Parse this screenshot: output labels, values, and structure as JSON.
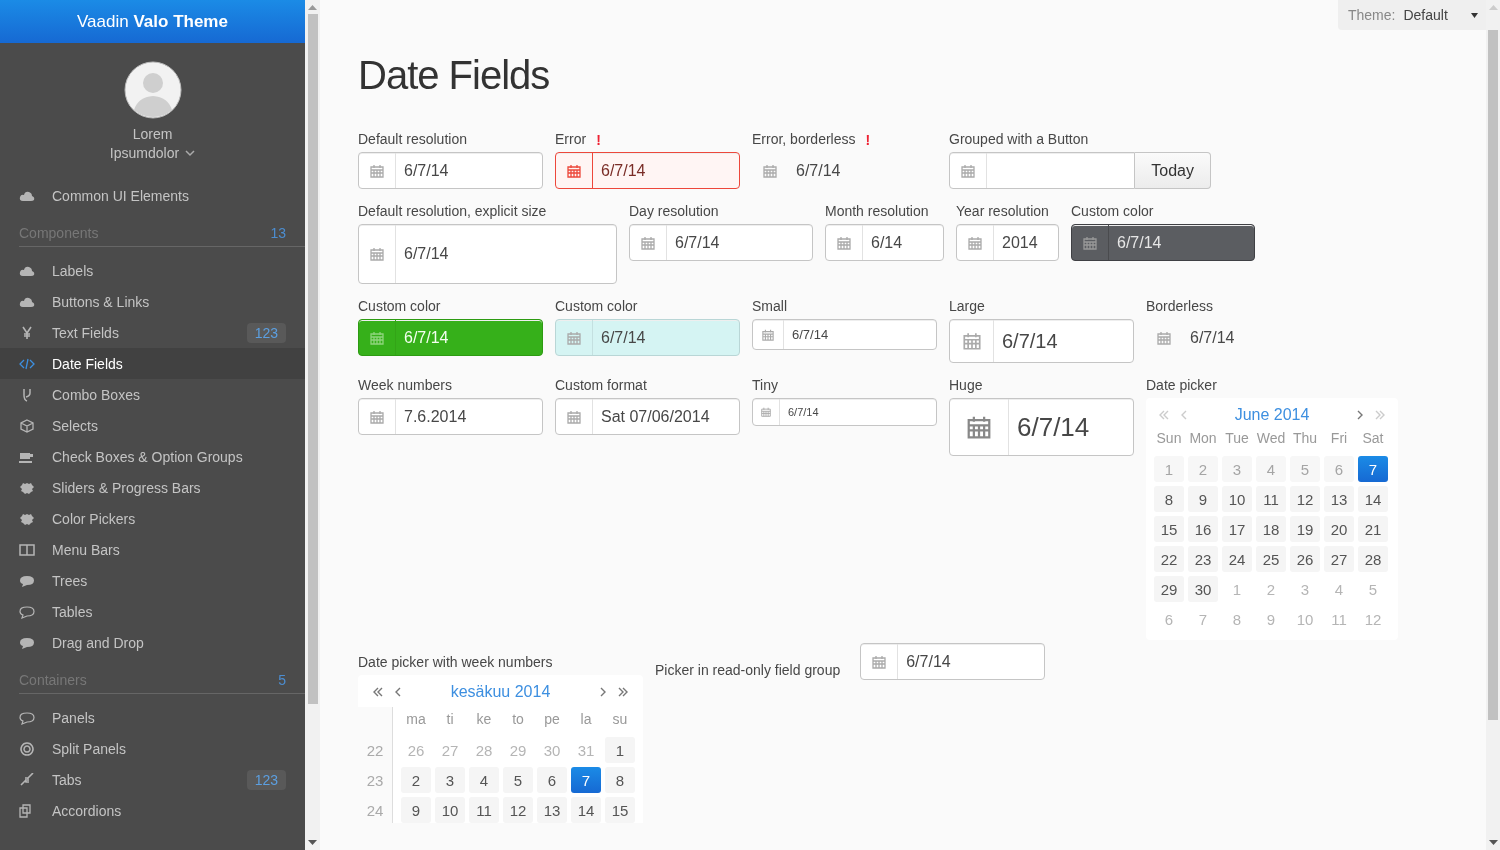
{
  "sidebar": {
    "title": "Vaadin **Valo Theme**",
    "user": {
      "first": "Lorem",
      "last": "Ipsumdolor"
    },
    "menu": [
      {
        "kind": "item",
        "label": "Common UI Elements",
        "selected": false
      },
      {
        "kind": "section",
        "label": "Components",
        "count": "13"
      },
      {
        "kind": "item",
        "label": "Labels",
        "selected": false
      },
      {
        "kind": "item",
        "label": "Buttons & Links",
        "selected": false
      },
      {
        "kind": "item",
        "label": "Text Fields",
        "badge": "123",
        "selected": false
      },
      {
        "kind": "item",
        "label": "Date Fields",
        "selected": true
      },
      {
        "kind": "item",
        "label": "Combo Boxes",
        "selected": false
      },
      {
        "kind": "item",
        "label": "Selects",
        "selected": false
      },
      {
        "kind": "item",
        "label": "Check Boxes & Option Groups",
        "selected": false
      },
      {
        "kind": "item",
        "label": "Sliders & Progress Bars",
        "selected": false
      },
      {
        "kind": "item",
        "label": "Color Pickers",
        "selected": false
      },
      {
        "kind": "item",
        "label": "Menu Bars",
        "selected": false
      },
      {
        "kind": "item",
        "label": "Trees",
        "selected": false
      },
      {
        "kind": "item",
        "label": "Tables",
        "selected": false
      },
      {
        "kind": "item",
        "label": "Drag and Drop",
        "selected": false
      },
      {
        "kind": "section",
        "label": "Containers",
        "count": "5"
      },
      {
        "kind": "item",
        "label": "Panels",
        "selected": false
      },
      {
        "kind": "item",
        "label": "Split Panels",
        "selected": false
      },
      {
        "kind": "item",
        "label": "Tabs",
        "badge": "123",
        "selected": false
      },
      {
        "kind": "item",
        "label": "Accordions",
        "selected": false
      }
    ]
  },
  "theme_select": {
    "label": "Theme:",
    "value": "Default"
  },
  "title": "Date Fields",
  "rows": [
    [
      {
        "label": "Default resolution",
        "value": "6/7/14",
        "kind": "default"
      },
      {
        "label": "Error",
        "error_mark": "!",
        "value": "6/7/14",
        "kind": "error"
      },
      {
        "label": "Error, borderless",
        "error_mark": "!",
        "value": "6/7/14",
        "kind": "borderless"
      },
      {
        "label": "Grouped with a Button",
        "button": "Today",
        "kind": "grouped"
      }
    ],
    [
      {
        "label": "Default resolution, explicit size",
        "value": "6/7/14",
        "kind": "explicit"
      },
      {
        "label": "Day resolution",
        "value": "6/7/14",
        "kind": "default"
      },
      {
        "label": "Month resolution",
        "value": "6/14",
        "kind": "default"
      },
      {
        "label": "Year resolution",
        "value": "2014",
        "kind": "default"
      },
      {
        "label": "Custom color",
        "value": "6/7/14",
        "kind": "dark"
      }
    ],
    [
      {
        "label": "Custom color",
        "value": "6/7/14",
        "kind": "green"
      },
      {
        "label": "Custom color",
        "value": "6/7/14",
        "kind": "cyan"
      },
      {
        "label": "Small",
        "value": "6/7/14",
        "kind": "small"
      },
      {
        "label": "Large",
        "value": "6/7/14",
        "kind": "large"
      },
      {
        "label": "Borderless",
        "value": "6/7/14",
        "kind": "borderless"
      }
    ],
    [
      {
        "label": "Week numbers",
        "value": "7.6.2014",
        "kind": "default"
      },
      {
        "label": "Custom format",
        "value": "Sat 07/06/2014",
        "kind": "default"
      },
      {
        "label": "Tiny",
        "value": "6/7/14",
        "kind": "tiny"
      },
      {
        "label": "Huge",
        "value": "6/7/14",
        "kind": "huge"
      }
    ]
  ],
  "date_picker": {
    "label": "Date picker",
    "month": "June 2014",
    "prev_disabled": true,
    "weekdays": [
      "Sun",
      "Mon",
      "Tue",
      "Wed",
      "Thu",
      "Fri",
      "Sat"
    ],
    "weeks": [
      [
        {
          "day": "1",
          "muted": false,
          "disabled": true,
          "selected": false
        },
        {
          "day": "2",
          "muted": false,
          "disabled": true,
          "selected": false
        },
        {
          "day": "3",
          "muted": false,
          "disabled": true,
          "selected": false
        },
        {
          "day": "4",
          "muted": false,
          "disabled": true,
          "selected": false
        },
        {
          "day": "5",
          "muted": false,
          "disabled": true,
          "selected": false
        },
        {
          "day": "6",
          "muted": false,
          "disabled": true,
          "selected": false
        },
        {
          "day": "7",
          "muted": false,
          "disabled": false,
          "selected": true
        }
      ],
      [
        {
          "day": "8",
          "muted": false,
          "selected": false
        },
        {
          "day": "9",
          "muted": false,
          "selected": false
        },
        {
          "day": "10",
          "muted": false,
          "selected": false
        },
        {
          "day": "11",
          "muted": false,
          "selected": false
        },
        {
          "day": "12",
          "muted": false,
          "selected": false
        },
        {
          "day": "13",
          "muted": false,
          "selected": false
        },
        {
          "day": "14",
          "muted": false,
          "selected": false
        }
      ],
      [
        {
          "day": "15",
          "muted": false,
          "selected": false
        },
        {
          "day": "16",
          "muted": false,
          "selected": false
        },
        {
          "day": "17",
          "muted": false,
          "selected": false
        },
        {
          "day": "18",
          "muted": false,
          "selected": false
        },
        {
          "day": "19",
          "muted": false,
          "selected": false
        },
        {
          "day": "20",
          "muted": false,
          "selected": false
        },
        {
          "day": "21",
          "muted": false,
          "selected": false
        }
      ],
      [
        {
          "day": "22",
          "muted": false,
          "selected": false
        },
        {
          "day": "23",
          "muted": false,
          "selected": false
        },
        {
          "day": "24",
          "muted": false,
          "selected": false
        },
        {
          "day": "25",
          "muted": false,
          "selected": false
        },
        {
          "day": "26",
          "muted": false,
          "selected": false
        },
        {
          "day": "27",
          "muted": false,
          "selected": false
        },
        {
          "day": "28",
          "muted": false,
          "selected": false
        }
      ],
      [
        {
          "day": "29",
          "muted": false,
          "selected": false
        },
        {
          "day": "30",
          "muted": false,
          "selected": false
        },
        {
          "day": "1",
          "muted": true,
          "selected": false
        },
        {
          "day": "2",
          "muted": true,
          "selected": false
        },
        {
          "day": "3",
          "muted": true,
          "selected": false
        },
        {
          "day": "4",
          "muted": true,
          "selected": false
        },
        {
          "day": "5",
          "muted": true,
          "selected": false
        }
      ],
      [
        {
          "day": "6",
          "muted": true,
          "selected": false
        },
        {
          "day": "7",
          "muted": true,
          "selected": false
        },
        {
          "day": "8",
          "muted": true,
          "selected": false
        },
        {
          "day": "9",
          "muted": true,
          "selected": false
        },
        {
          "day": "10",
          "muted": true,
          "selected": false
        },
        {
          "day": "11",
          "muted": true,
          "selected": false
        },
        {
          "day": "12",
          "muted": true,
          "selected": false
        }
      ]
    ]
  },
  "week_picker": {
    "label": "Date picker with week numbers",
    "month": "kesäkuu 2014",
    "prev_disabled": false,
    "weekdays": [
      "ma",
      "ti",
      "ke",
      "to",
      "pe",
      "la",
      "su"
    ],
    "weeks": [
      {
        "number": "22",
        "days": [
          {
            "day": "26",
            "muted": true,
            "selected": false
          },
          {
            "day": "27",
            "muted": true,
            "selected": false
          },
          {
            "day": "28",
            "muted": true,
            "selected": false
          },
          {
            "day": "29",
            "muted": true,
            "selected": false
          },
          {
            "day": "30",
            "muted": true,
            "selected": false
          },
          {
            "day": "31",
            "muted": true,
            "selected": false
          },
          {
            "day": "1",
            "muted": false,
            "selected": false
          }
        ]
      },
      {
        "number": "23",
        "days": [
          {
            "day": "2",
            "muted": false,
            "selected": false
          },
          {
            "day": "3",
            "muted": false,
            "selected": false
          },
          {
            "day": "4",
            "muted": false,
            "selected": false
          },
          {
            "day": "5",
            "muted": false,
            "selected": false
          },
          {
            "day": "6",
            "muted": false,
            "selected": false
          },
          {
            "day": "7",
            "muted": false,
            "selected": true
          },
          {
            "day": "8",
            "muted": false,
            "selected": false
          }
        ]
      },
      {
        "number": "24",
        "days": [
          {
            "day": "9",
            "muted": false,
            "selected": false
          },
          {
            "day": "10",
            "muted": false,
            "selected": false
          },
          {
            "day": "11",
            "muted": false,
            "selected": false
          },
          {
            "day": "12",
            "muted": false,
            "selected": false
          },
          {
            "day": "13",
            "muted": false,
            "selected": false
          },
          {
            "day": "14",
            "muted": false,
            "selected": false
          },
          {
            "day": "15",
            "muted": false,
            "selected": false
          }
        ]
      }
    ]
  },
  "readonly_group": {
    "label": "Picker in read-only field group",
    "value": "6/7/14"
  }
}
